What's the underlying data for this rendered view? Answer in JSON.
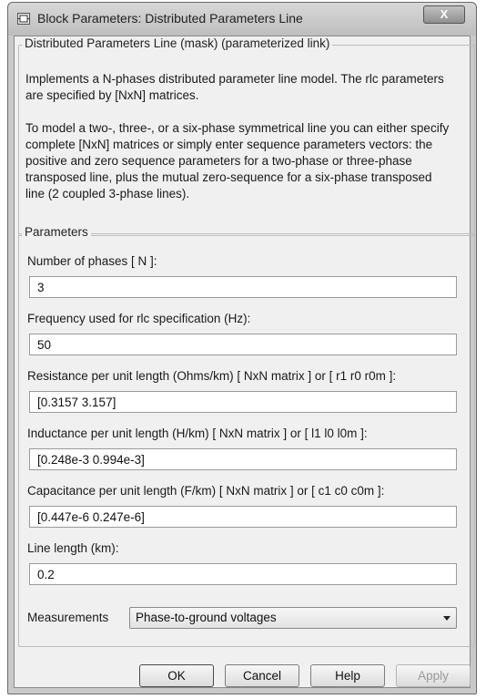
{
  "window": {
    "title": "Block Parameters: Distributed Parameters Line",
    "close_label": "X"
  },
  "mask": {
    "group_title": "Distributed Parameters Line (mask) (parameterized link)",
    "description_1": "Implements a N-phases distributed parameter line model. The rlc parameters are specified by [NxN] matrices.",
    "description_2": "To model a two-, three-, or a six-phase symmetrical line you can either specify complete [NxN] matrices or simply enter sequence parameters vectors: the  positive and zero sequence parameters for a two-phase or  three-phase transposed  line, plus the mutual zero-sequence for a  six-phase transposed  line  (2 coupled 3-phase lines)."
  },
  "parameters": {
    "group_title": "Parameters",
    "fields": [
      {
        "label": "Number of phases [ N ]:",
        "value": "3"
      },
      {
        "label": "Frequency used for rlc specification (Hz):",
        "value": "50"
      },
      {
        "label": "Resistance per unit length (Ohms/km) [ NxN matrix ] or [ r1 r0 r0m ]:",
        "value": "[0.3157 3.157]"
      },
      {
        "label": "Inductance per unit length (H/km) [ NxN matrix ] or [ l1 l0 l0m ]:",
        "value": "[0.248e-3 0.994e-3]"
      },
      {
        "label": "Capacitance per unit length (F/km) [ NxN matrix ] or [ c1 c0 c0m ]:",
        "value": "[0.447e-6 0.247e-6]"
      },
      {
        "label": "Line length (km):",
        "value": "0.2"
      }
    ],
    "measurements_label": "Measurements",
    "measurements_value": "Phase-to-ground voltages"
  },
  "buttons": {
    "ok": "OK",
    "cancel": "Cancel",
    "help": "Help",
    "apply": "Apply"
  }
}
